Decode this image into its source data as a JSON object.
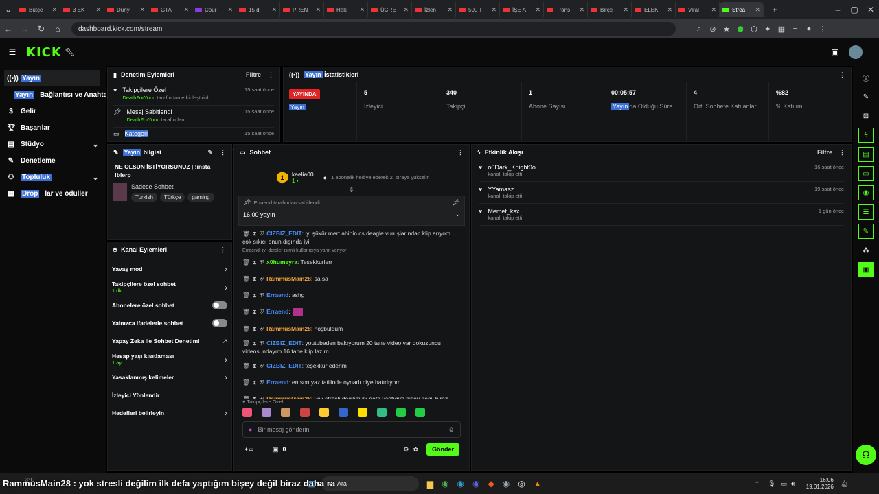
{
  "browser": {
    "tabs": [
      "Bütçe",
      "3 EK",
      "Düny",
      "GTA",
      "Cour",
      "15 di",
      "PREN",
      "Heki",
      "ÜCRE",
      "İzlen",
      "500 T",
      "İŞE A",
      "Trans",
      "Birçe",
      "ELEK",
      "Viral",
      "Strea"
    ],
    "url": "dashboard.kick.com/stream"
  },
  "sidebar": {
    "items": [
      "Yayın",
      "Yayın",
      "Bağlantısı ve Anahtar",
      "Gelir",
      "Başarılar",
      "Stüdyo",
      "Denetleme",
      "Topluluk",
      "Drop",
      "lar ve ödüller"
    ]
  },
  "moderation": {
    "title": "Denetim Eylemleri",
    "filter": "Filtre",
    "items": [
      {
        "title": "Takipçilere Özel",
        "by": "DeathForYouu",
        "desc": "tarafından etkinleştirildi",
        "time": "15 saat önce"
      },
      {
        "title": "Mesaj Sabitlendi",
        "by": "DeathForYouu",
        "desc": "tarafından",
        "time": "15 saat önce"
      },
      {
        "title": "Kategori",
        "by": "",
        "desc": "",
        "time": "15 saat önce"
      }
    ]
  },
  "stats": {
    "title_hl": "Yayın",
    "title": "İstatistikleri",
    "live": "YAYINDA",
    "live_sub": "Yayın",
    "cells": [
      {
        "v": "5",
        "l": "İzleyici"
      },
      {
        "v": "340",
        "l": "Takipçi"
      },
      {
        "v": "1",
        "l": "Abone Sayısı"
      },
      {
        "v": "00:05:57",
        "l": "da Olduğu Süre",
        "hl": "Yayın"
      },
      {
        "v": "4",
        "l": "Ort. Sohbete Katılanlar"
      },
      {
        "v": "%82",
        "l": "% Katılım"
      }
    ]
  },
  "info": {
    "title_hl": "Yayın",
    "title": "bilgisi",
    "stream_title": "NE OLSUN İSTİYORSUNUZ | !insta !blerp",
    "category": "Sadece Sohbet",
    "tags": [
      "Turkish",
      "Türkçe",
      "gaming"
    ]
  },
  "channel": {
    "title": "Kanal Eylemleri",
    "items": [
      {
        "label": "Yavaş mod",
        "sub": "",
        "ctrl": "chev"
      },
      {
        "label": "Takipçilere özel sohbet",
        "sub": "1 dk.",
        "ctrl": "chev"
      },
      {
        "label": "Abonelere özel sohbet",
        "sub": "",
        "ctrl": "toggle"
      },
      {
        "label": "Yalnızca ifadelerle sohbet",
        "sub": "",
        "ctrl": "toggle"
      },
      {
        "label": "Yapay Zeka ile Sohbet Denetimi",
        "sub": "",
        "ctrl": "ext"
      },
      {
        "label": "Hesap yaşı kısıtlaması",
        "sub": "1 ay",
        "ctrl": "chev"
      },
      {
        "label": "Yasaklanmış kelimeler",
        "sub": "",
        "ctrl": "chev"
      },
      {
        "label": "İzleyici Yönlendir",
        "sub": "",
        "ctrl": "none"
      },
      {
        "label": "Hedefleri belirleyin",
        "sub": "",
        "ctrl": "chev"
      }
    ]
  },
  "chat": {
    "title": "Sohbet",
    "gifter": "kaelia00",
    "gift_text": "1 abonelik hediye ederek 2. sıraya yükselin",
    "pinned_by": "Erraend tarafından sabitlendi",
    "pinned_text": "16.00 yayın",
    "reply_note": "Erraend: iyi dersler isimli kullanıcıya yanıt veriyor",
    "messages": [
      {
        "user": "CIZBIZ_EDIT",
        "color": "blue",
        "text": ": iyi şükür mert abinin cs deagle vuruşlarından klip arıyom çok sıkıcı onun dışında iyi"
      },
      {
        "user": "x0humeyra",
        "color": "green",
        "text": ": Tesekkurlerr"
      },
      {
        "user": "RammusMain28",
        "color": "orange",
        "text": ": sa sa"
      },
      {
        "user": "Erraend",
        "color": "blue",
        "text": ": ashg"
      },
      {
        "user": "Erraend",
        "color": "blue",
        "text": ":"
      },
      {
        "user": "RammusMain28",
        "color": "orange",
        "text": ": hoşbuldum"
      },
      {
        "user": "CIZBIZ_EDIT",
        "color": "blue",
        "text": ": youtubeden bakıyorum 20 tane video var dokuzuncu videosundayım 16 tane klip lazım"
      },
      {
        "user": "CIZBIZ_EDIT",
        "color": "blue",
        "text": ": teşekkür ederim"
      },
      {
        "user": "Erraend",
        "color": "blue",
        "text": ": en son yaz tatilinde oynadı diye hatırlıyom"
      },
      {
        "user": "RammusMain28",
        "color": "orange",
        "text": ": yok stresli değilim ilk defa yaptığım bişey değil biraz daha rahatım"
      }
    ],
    "emote_label": "Takipçilere Özel",
    "placeholder": "Bir mesaj gönderin",
    "count": "0",
    "send": "Gönder"
  },
  "feed": {
    "title": "Etkinlik Akışı",
    "filter": "Filtre",
    "items": [
      {
        "user": "o0Dark_Knight0o",
        "action": "kanalı takip etti",
        "time": "16 saat önce"
      },
      {
        "user": "YYamasz",
        "action": "kanalı takip etti",
        "time": "19 saat önce"
      },
      {
        "user": "Memet_ksx",
        "action": "kanalı takip etti",
        "time": "1 gün önce"
      }
    ]
  },
  "taskbar": {
    "temp": "-3°C",
    "search": "Ara",
    "time": "16:06",
    "date": "19.01.2026"
  },
  "subtitle": "RammusMain28 : yok stresli değilim ilk defa yaptığım bişey değil biraz daha ra"
}
